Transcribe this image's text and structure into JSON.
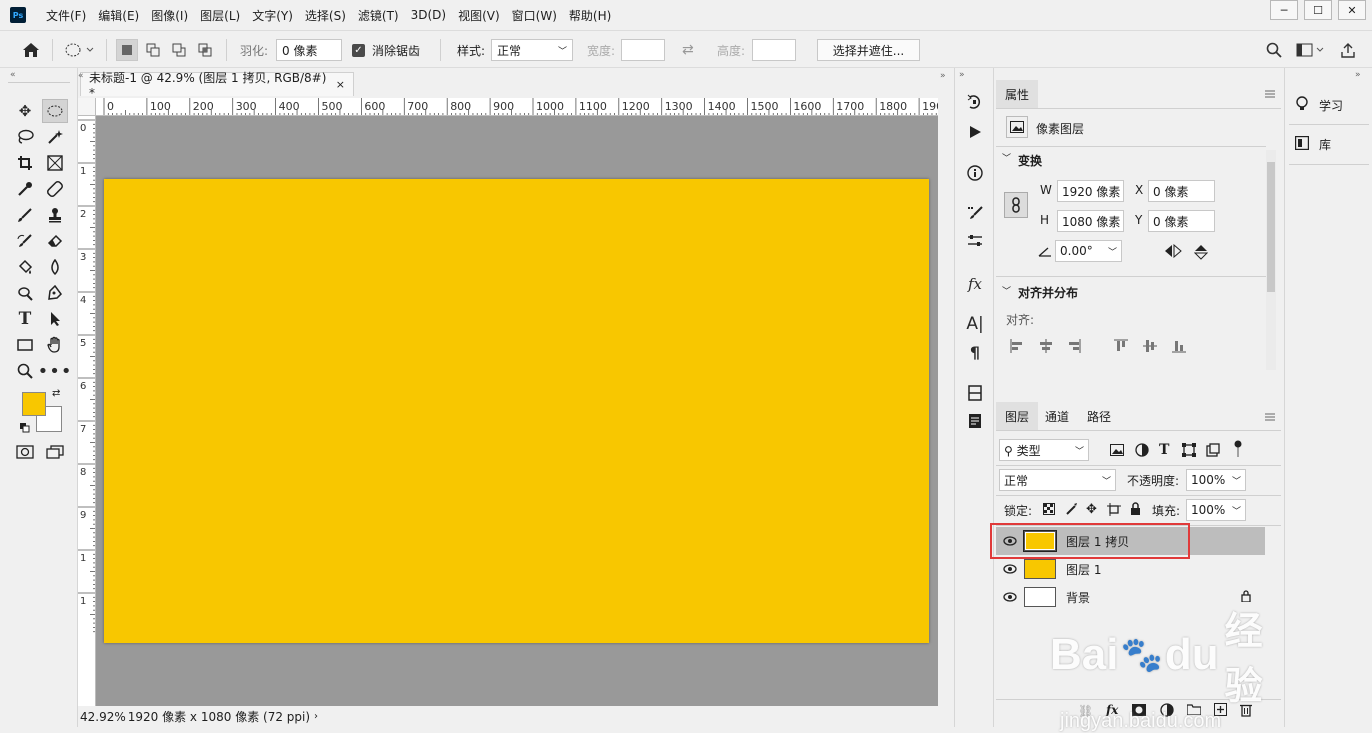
{
  "menubar": {
    "logo": "Ps",
    "items": [
      "文件(F)",
      "编辑(E)",
      "图像(I)",
      "图层(L)",
      "文字(Y)",
      "选择(S)",
      "滤镜(T)",
      "3D(D)",
      "视图(V)",
      "窗口(W)",
      "帮助(H)"
    ]
  },
  "options": {
    "feather_label": "羽化:",
    "feather_value": "0 像素",
    "antialias_label": "消除锯齿",
    "style_label": "样式:",
    "style_value": "正常",
    "width_label": "宽度:",
    "height_label": "高度:",
    "select_mask_button": "选择并遮住..."
  },
  "document": {
    "tab_title": "未标题-1 @ 42.9% (图层 1 拷贝, RGB/8#) *",
    "canvas_color": "#f8c700",
    "ruler_top_labels": [
      "0",
      "100",
      "200",
      "300",
      "400",
      "500",
      "600",
      "700",
      "800",
      "900",
      "1000",
      "1100",
      "1200",
      "1300",
      "1400",
      "1500",
      "1600",
      "1700",
      "1800",
      "190"
    ],
    "ruler_left_labels": [
      "0",
      "1",
      "2",
      "3",
      "4",
      "5",
      "6",
      "7",
      "8",
      "9",
      "1",
      "1"
    ],
    "status_zoom": "42.92%",
    "status_size": "1920 像素 x 1080 像素 (72 ppi)"
  },
  "properties": {
    "tab_label": "属性",
    "layer_type": "像素图层",
    "transform_title": "变换",
    "w_label": "W",
    "w_value": "1920 像素",
    "h_label": "H",
    "h_value": "1080 像素",
    "x_label": "X",
    "x_value": "0 像素",
    "y_label": "Y",
    "y_value": "0 像素",
    "angle_value": "0.00°",
    "align_title": "对齐并分布",
    "align_label": "对齐:"
  },
  "layers_panel": {
    "tabs": [
      "图层",
      "通道",
      "路径"
    ],
    "filter_value": "类型",
    "blend_mode": "正常",
    "opacity_label": "不透明度:",
    "opacity_value": "100%",
    "lock_label": "锁定:",
    "fill_label": "填充:",
    "fill_value": "100%",
    "layers": [
      {
        "name": "图层 1 拷贝",
        "thumb": "#f8c700",
        "selected": true
      },
      {
        "name": "图层 1",
        "thumb": "#f8c700",
        "selected": false
      },
      {
        "name": "背景",
        "thumb": "#ffffff",
        "selected": false
      }
    ]
  },
  "learn_panel": {
    "items": [
      "学习",
      "库"
    ]
  },
  "colors": {
    "foreground": "#f8c700",
    "background": "#ffffff",
    "highlight": "#e03a3a"
  },
  "watermark": {
    "brand": "Bai",
    "brand2": "du",
    "cn": "经验",
    "url": "jingyan.baidu.com"
  }
}
